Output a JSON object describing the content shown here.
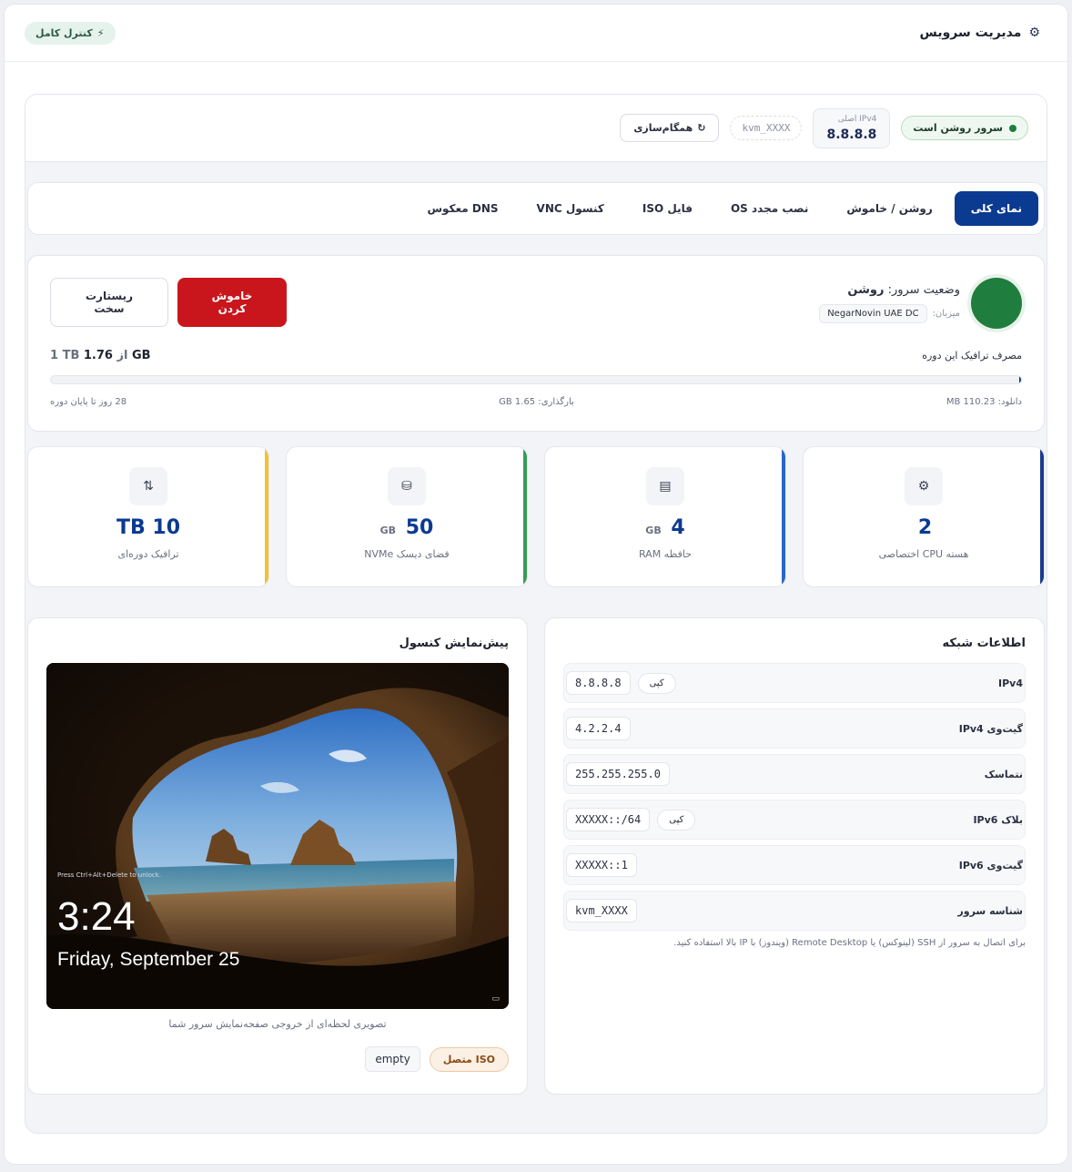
{
  "header": {
    "title": "مدیریت سرویس",
    "full_control": "کنترل کامل"
  },
  "hero": {
    "status_pill": "سرور روشن است",
    "ipv4_label": "IPv4 اصلی",
    "ipv4_value": "8.8.8.8",
    "server_id": "kvm_XXXX",
    "sync_label": "همگام‌سازی"
  },
  "tabs": [
    "نمای کلی",
    "روشن / خاموش",
    "نصب مجدد OS",
    "فایل ISO",
    "کنسول VNC",
    "DNS معکوس"
  ],
  "status": {
    "title_prefix": "وضعیت سرور:",
    "title_value": "روشن",
    "host_label": "میزبان:",
    "host_value": "NegarNovin UAE DC",
    "shutdown_label": "خاموش کردن",
    "hard_reset_label": "ریستارت سخت",
    "traffic_label": "مصرف ترافیک این دوره",
    "traffic_used": "1.76 GB",
    "traffic_of": "از",
    "traffic_total": "1 TB",
    "traffic_fraction": 0.0017,
    "download": "دانلود: 110.23 MB",
    "upload": "بارگذاری: 1.65 GB",
    "days_left": "28 روز تا پایان دوره"
  },
  "stats": [
    {
      "value": "2",
      "unit": "",
      "label": "هسته CPU اختصاصی",
      "icon": "cpu-icon",
      "accent": "#1b3d8f"
    },
    {
      "value": "4",
      "unit": "GB",
      "label": "حافظه RAM",
      "icon": "memory-icon",
      "accent": "#2a66c8"
    },
    {
      "value": "50",
      "unit": "GB",
      "label": "فضای دیسک NVMe",
      "icon": "disk-icon",
      "accent": "#3a9a5a"
    },
    {
      "value": "10",
      "unit": "TB",
      "label": "ترافیک دوره‌ای",
      "icon": "traffic-icon",
      "accent": "#f2c230"
    }
  ],
  "network": {
    "title": "اطلاعات شبکه",
    "copy_label": "کپی",
    "rows": [
      {
        "key": "IPv4",
        "value": "8.8.8.8",
        "copy": true
      },
      {
        "key": "گیت‌وی IPv4",
        "value": "4.2.2.4",
        "copy": false
      },
      {
        "key": "نتماسک",
        "value": "255.255.255.0",
        "copy": false
      },
      {
        "key": "بلاک IPv6",
        "value": "XXXXX::/64",
        "copy": true
      },
      {
        "key": "گیت‌وی IPv6",
        "value": "XXXXX::1",
        "copy": false
      },
      {
        "key": "شناسه سرور",
        "value": "kvm_XXXX",
        "copy": false
      }
    ],
    "hint": "برای اتصال به سرور از SSH (لینوکس) یا Remote Desktop (ویندوز) با IP بالا استفاده کنید."
  },
  "console": {
    "title": "پیش‌نمایش کنسول",
    "lock_hint": "Press Ctrl+Alt+Delete to unlock.",
    "clock": "3:24",
    "date": "Friday, September 25",
    "caption": "تصویری لحظه‌ای از خروجی صفحه‌نمایش سرور شما",
    "iso_badge": "ISO متصل",
    "iso_value": "empty"
  }
}
